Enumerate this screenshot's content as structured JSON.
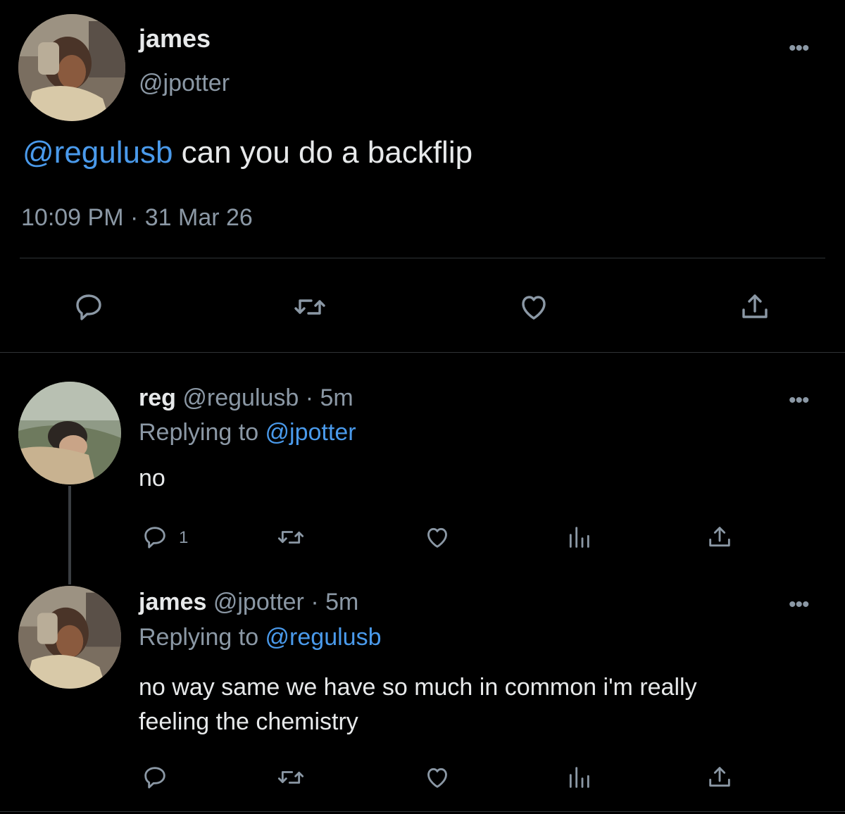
{
  "main_tweet": {
    "name": "james",
    "handle": "@jpotter",
    "mention": "@regulusb",
    "text": " can you do a backflip",
    "timestamp": "10:09 PM · 31 Mar 26",
    "more": "•••",
    "actions": [
      "reply-icon",
      "retweet-icon",
      "like-icon",
      "share-icon"
    ]
  },
  "replies": [
    {
      "name": "reg",
      "handle": "@regulusb",
      "time": " · 5m",
      "replying_label": "Replying to ",
      "replying_to": "@jpotter",
      "text": "no",
      "reply_count": "1",
      "more": "•••",
      "actions": [
        "reply-icon",
        "retweet-icon",
        "like-icon",
        "views-icon",
        "share-icon"
      ]
    },
    {
      "name": "james",
      "handle": "@jpotter",
      "time": " · 5m",
      "replying_label": "Replying to ",
      "replying_to": "@regulusb",
      "text_line1": "no way same we have so much in common i'm really",
      "text_line2": "feeling the chemistry",
      "more": "•••",
      "actions": [
        "reply-icon",
        "retweet-icon",
        "like-icon",
        "views-icon",
        "share-icon"
      ]
    }
  ],
  "colors": {
    "background": "#000000",
    "text": "#e7e9ea",
    "muted": "#8b98a5",
    "link": "#4a9aeb",
    "divider": "#2f3336"
  }
}
